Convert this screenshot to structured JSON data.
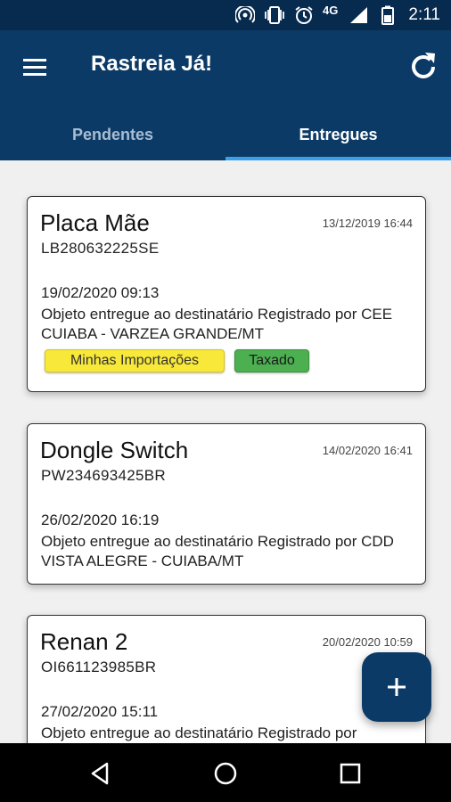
{
  "status_bar": {
    "time": "2:11",
    "network": "4G",
    "icons": [
      "hotspot-icon",
      "vibrate-icon",
      "alarm-icon",
      "signal-icon",
      "battery-icon"
    ]
  },
  "app_bar": {
    "title": "Rastreia Já!",
    "background": "#0c3a66",
    "icons": [
      "menu-icon",
      "refresh-icon"
    ]
  },
  "tabs": [
    {
      "label": "Pendentes",
      "active": false
    },
    {
      "label": "Entregues",
      "active": true
    }
  ],
  "packages": [
    {
      "title": "Placa Mãe",
      "code": "LB280632225SE",
      "date": "13/12/2019 16:44",
      "update_time": "19/02/2020 09:13",
      "description": "Objeto entregue ao destinatário Registrado por CEE CUIABA - VARZEA GRANDE/MT",
      "tags": [
        {
          "label": "Minhas Importações",
          "color": "#f7e83a"
        },
        {
          "label": "Taxado",
          "color": "#4caf50"
        }
      ]
    },
    {
      "title": "Dongle Switch",
      "code": "PW234693425BR",
      "date": "14/02/2020 16:41",
      "update_time": "26/02/2020 16:19",
      "description": "Objeto entregue ao destinatário Registrado por CDD VISTA ALEGRE - CUIABA/MT",
      "tags": []
    },
    {
      "title": "Renan 2",
      "code": "OI661123985BR",
      "date": "20/02/2020 10:59",
      "update_time": "27/02/2020 15:11",
      "description": "Objeto entregue ao destinatário Registrado por",
      "tags": []
    }
  ],
  "fab": {
    "icon": "plus-icon"
  },
  "nav_bar": {
    "icons": [
      "back-icon",
      "home-icon",
      "recents-icon"
    ]
  }
}
